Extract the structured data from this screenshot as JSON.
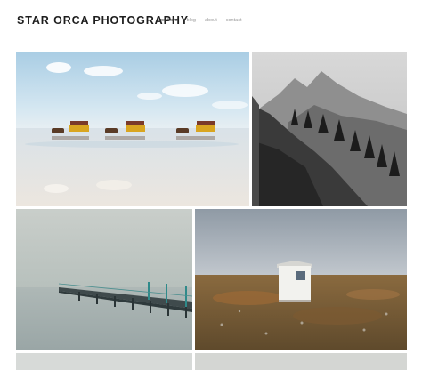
{
  "site": {
    "title": "STAR ORCA PHOTOGRAPHY"
  },
  "nav": [
    {
      "label": "portfolio",
      "active": true
    },
    {
      "label": "blog",
      "active": false
    },
    {
      "label": "about",
      "active": false
    },
    {
      "label": "contact",
      "active": false
    }
  ],
  "gallery": {
    "photos": [
      {
        "icon": "horse-carriages-beach-photo",
        "tone": "color"
      },
      {
        "icon": "mountain-cliff-photo",
        "tone": "black-and-white"
      },
      {
        "icon": "pier-fog-photo",
        "tone": "color"
      },
      {
        "icon": "white-hut-tundra-photo",
        "tone": "color"
      },
      {
        "icon": "partial-photo",
        "tone": "color"
      },
      {
        "icon": "partial-photo",
        "tone": "color"
      }
    ]
  },
  "colors": {
    "title": "#1e1e1e",
    "nav_active": "#333333",
    "nav_inactive": "#9a9a9a",
    "background": "#ffffff"
  }
}
